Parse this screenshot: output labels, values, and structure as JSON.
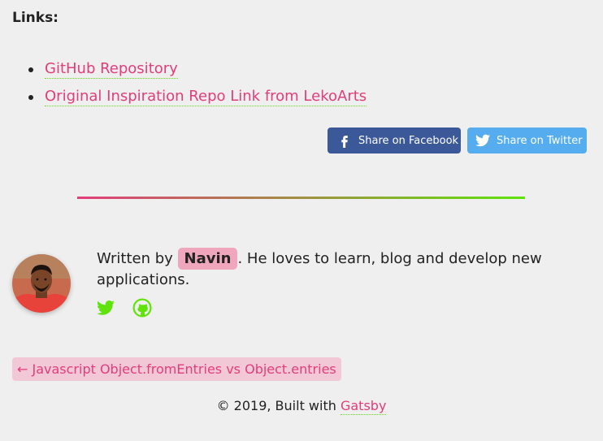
{
  "links": {
    "heading": "Links:",
    "items": [
      {
        "label": "GitHub Repository"
      },
      {
        "label": "Original Inspiration Repo Link from LekoArts"
      }
    ]
  },
  "share": {
    "facebook_label": "Share on Facebook",
    "twitter_label": "Share on Twitter",
    "facebook_color": "#3b5998",
    "twitter_color": "#55acee",
    "facebook_icon": "facebook-icon",
    "twitter_icon": "twitter-icon"
  },
  "author": {
    "prefix": "Written by",
    "name": "Navin",
    "bio_rest": ". He loves to learn, blog and develop new applications.",
    "avatar_icon": "author-avatar",
    "social_icons": [
      "twitter-icon",
      "github-icon"
    ],
    "social_color": "#5fe30a"
  },
  "navigation": {
    "previous_label": "← Javascript Object.fromEntries vs Object.entries"
  },
  "footer": {
    "text": "© 2019, Built with",
    "link_label": "Gatsby"
  },
  "colors": {
    "accent_pink": "#e23d7b",
    "accent_green": "#5fe30a",
    "background": "#efefef"
  }
}
